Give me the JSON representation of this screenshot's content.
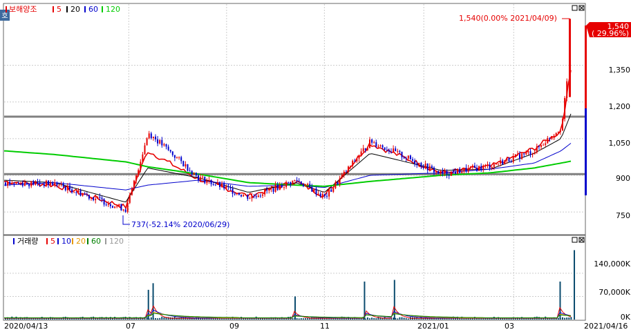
{
  "legend_price": {
    "stock": "보해양조",
    "ma": [
      {
        "label": "5",
        "color": "#e60000"
      },
      {
        "label": "20",
        "color": "#000000"
      },
      {
        "label": "60",
        "color": "#0000cc"
      },
      {
        "label": "120",
        "color": "#00cc00"
      }
    ]
  },
  "legend_volume": {
    "title": "거래량",
    "ma": [
      {
        "label": "5",
        "color": "#e60000"
      },
      {
        "label": "10",
        "color": "#0000cc"
      },
      {
        "label": "20",
        "color": "#e69900"
      },
      {
        "label": "60",
        "color": "#008000"
      },
      {
        "label": "120",
        "color": "#999999"
      }
    ]
  },
  "side_tab": "호",
  "price_axis": {
    "ticks": [
      "1,350",
      "1,200",
      "1,050",
      "900",
      "750"
    ]
  },
  "volume_axis": {
    "ticks": [
      "140,000K",
      "70,000K",
      "0K"
    ]
  },
  "x_axis": {
    "ticks": [
      "2020/04/13",
      "07",
      "09",
      "11",
      "2021/01",
      "03",
      "2021/04/16"
    ]
  },
  "annotations": {
    "high": "1,540(0.00% 2021/04/09)",
    "low": "737(-52.14% 2020/06/29)"
  },
  "current_price": {
    "value": "1,540",
    "change": "( 29.96%)"
  },
  "colors": {
    "up": "#e60000",
    "down": "#0000cc",
    "price_tag": "#e60000"
  },
  "chart_data": [
    {
      "type": "line",
      "title": "보해양조",
      "x": [
        "2020/04/13",
        "2020/05/15",
        "2020/06/29",
        "2020/07/13",
        "2020/08/14",
        "2020/09/15",
        "2020/10/15",
        "2020/11/02",
        "2020/12/01",
        "2021/01/15",
        "2021/02/15",
        "2021/03/15",
        "2021/04/01",
        "2021/04/09",
        "2021/04/16"
      ],
      "series": [
        {
          "name": "close",
          "values": [
            870,
            865,
            760,
            1075,
            890,
            810,
            880,
            810,
            1040,
            905,
            940,
            1000,
            1100,
            1540,
            1540
          ]
        },
        {
          "name": "5",
          "values": [
            875,
            860,
            770,
            1000,
            885,
            815,
            875,
            815,
            1030,
            910,
            935,
            1010,
            1080,
            1400,
            1480
          ]
        },
        {
          "name": "20",
          "values": [
            880,
            870,
            790,
            930,
            890,
            830,
            870,
            830,
            990,
            920,
            925,
            990,
            1050,
            1180,
            1250
          ]
        },
        {
          "name": "60",
          "values": [
            860,
            870,
            840,
            860,
            880,
            855,
            860,
            850,
            900,
            910,
            925,
            950,
            1000,
            1040,
            1070
          ]
        },
        {
          "name": "120",
          "values": [
            1000,
            985,
            955,
            935,
            905,
            870,
            860,
            855,
            875,
            900,
            910,
            930,
            950,
            960,
            970
          ]
        }
      ],
      "horizontal_lines": [
        1140,
        905
      ],
      "ylim": [
        660,
        1600
      ]
    },
    {
      "type": "bar",
      "title": "거래량",
      "x": [
        "2020/07/13",
        "2020/07/16",
        "2020/10/14",
        "2020/11/27",
        "2020/12/16",
        "2021/03/31",
        "2021/04/09"
      ],
      "values": [
        90000,
        110000,
        70000,
        115000,
        120000,
        115000,
        210000
      ],
      "ylim": [
        0,
        215000
      ]
    }
  ]
}
